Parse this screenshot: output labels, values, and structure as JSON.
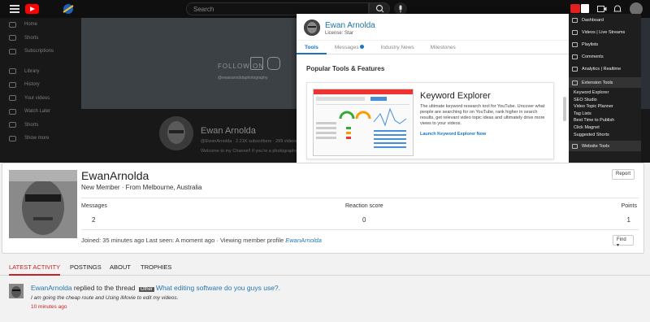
{
  "youtube": {
    "search_placeholder": "Search",
    "sidebar": [
      {
        "label": "Home"
      },
      {
        "label": "Shorts"
      },
      {
        "label": "Subscriptions"
      },
      {
        "label": "Library"
      },
      {
        "label": "History"
      },
      {
        "label": "Your videos"
      },
      {
        "label": "Watch Later"
      },
      {
        "label": "Shorts"
      },
      {
        "label": "Show more"
      }
    ],
    "banner": {
      "follow_text": "FOLLOW ON",
      "handle": "@ewanarnoldaphotography"
    },
    "channel": {
      "name": "Ewan Arnolda",
      "meta": "@EwanArnolda · 2.21K subscribers · 299 videos",
      "desc": "Welcome to my Channel! If you're a photographer..."
    }
  },
  "popup": {
    "name": "Ewan Arnolda",
    "license": "License: Star",
    "tabs": [
      {
        "label": "Tools"
      },
      {
        "label": "Messages"
      },
      {
        "label": "Industry News"
      },
      {
        "label": "Milestones"
      }
    ],
    "section": "Popular Tools & Features",
    "card": {
      "title": "Keyword Explorer",
      "desc": "The ultimate keyword research tool for YouTube. Uncover what people are searching for on YouTube, rank higher in search results, get relevant video topic ideas and ultimately drive more views to your videos.",
      "link": "Launch Keyword Explorer Now"
    }
  },
  "ext_menu": {
    "items": [
      {
        "label": "Dashboard"
      },
      {
        "label": "Videos  |  Live Streams"
      },
      {
        "label": "Playlists"
      },
      {
        "label": "Comments"
      },
      {
        "label": "Analytics  |  Realtime"
      }
    ],
    "extension_tools": "Extension Tools",
    "sub_items": [
      "Keyword Explorer",
      "SEO Studio",
      "Video Topic Planner",
      "Tag Lists",
      "Best Time to Publish",
      "Click Magnet",
      "Suggested Shorts"
    ],
    "website_tools": "Website Tools"
  },
  "profile": {
    "name": "EwanArnolda",
    "title": "New Member · From Melbourne, Australia",
    "report": "Report",
    "find": "Find",
    "stats": [
      {
        "label": "Messages",
        "value": "2"
      },
      {
        "label": "Reaction score",
        "value": "0"
      },
      {
        "label": "Points",
        "value": "1"
      }
    ],
    "joined": "Joined: 35 minutes ago   Last seen: A moment ago · Viewing member profile",
    "joined_link": "EwanArnolda"
  },
  "tabs": [
    {
      "label": "LATEST ACTIVITY"
    },
    {
      "label": "POSTINGS"
    },
    {
      "label": "ABOUT"
    },
    {
      "label": "TROPHIES"
    }
  ],
  "activity": {
    "user": "EwanArnolda",
    "action": " replied to the thread ",
    "tag": "Other",
    "thread": "What editing software do you guys use?.",
    "snippet": "I am going the cheap route and Using iMovie to edit my videos.",
    "time": "10 minutes ago"
  },
  "colors": {
    "accent_red": "#c92121",
    "link_blue": "#2577b1",
    "popup_blue": "#1a73c8",
    "youtube_red": "#ff0000"
  }
}
